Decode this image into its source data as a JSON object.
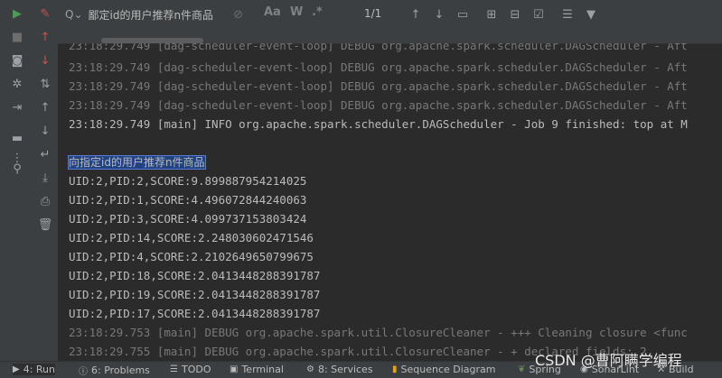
{
  "search": {
    "value": "鄙定id的用户推荐n件商品",
    "match_count": "1/1"
  },
  "toolbar": {
    "match_case": "Aa",
    "words": "W",
    "regex": ".*"
  },
  "console_lines": [
    "23:18:29.749 [dag-scheduler-event-loop] DEBUG org.apache.spark.scheduler.DAGScheduler - Aft",
    "23:18:29.749 [dag-scheduler-event-loop] DEBUG org.apache.spark.scheduler.DAGScheduler - Aft",
    "23:18:29.749 [dag-scheduler-event-loop] DEBUG org.apache.spark.scheduler.DAGScheduler - Aft",
    "23:18:29.749 [dag-scheduler-event-loop] DEBUG org.apache.spark.scheduler.DAGScheduler - Aft",
    "23:18:29.749 [main] INFO org.apache.spark.scheduler.DAGScheduler - Job 9 finished: top at M",
    "",
    "向指定id的用户推荐n件商品",
    "UID:2,PID:2,SCORE:9.899887954214025",
    "UID:2,PID:1,SCORE:4.496072844240063",
    "UID:2,PID:3,SCORE:4.099737153803424",
    "UID:2,PID:14,SCORE:2.248030602471546",
    "UID:2,PID:4,SCORE:2.2102649650799675",
    "UID:2,PID:18,SCORE:2.0413448288391787",
    "UID:2,PID:19,SCORE:2.0413448288391787",
    "UID:2,PID:17,SCORE:2.0413448288391787",
    "23:18:29.753 [main] DEBUG org.apache.spark.util.ClosureCleaner - +++ Cleaning closure <func",
    "23:18:29.755 [main] DEBUG org.apache.spark.util.ClosureCleaner - + declared fields: 2"
  ],
  "bottom_tabs": [
    {
      "key": "4",
      "label": "4: Run"
    },
    {
      "key": "6",
      "label": "6: Problems"
    },
    {
      "key": "todo",
      "label": "TODO"
    },
    {
      "key": "terminal",
      "label": "Terminal"
    },
    {
      "key": "8",
      "label": "8: Services"
    },
    {
      "key": "seq",
      "label": "Sequence Diagram"
    },
    {
      "key": "spring",
      "label": "Spring"
    },
    {
      "key": "sonar",
      "label": "SonarLint"
    },
    {
      "key": "build",
      "label": "Build"
    }
  ],
  "watermark": "CSDN @曹阿瞒学编程",
  "colors": {
    "run_green": "#499c54",
    "stop_red": "#c75450",
    "selection": "#214283"
  }
}
